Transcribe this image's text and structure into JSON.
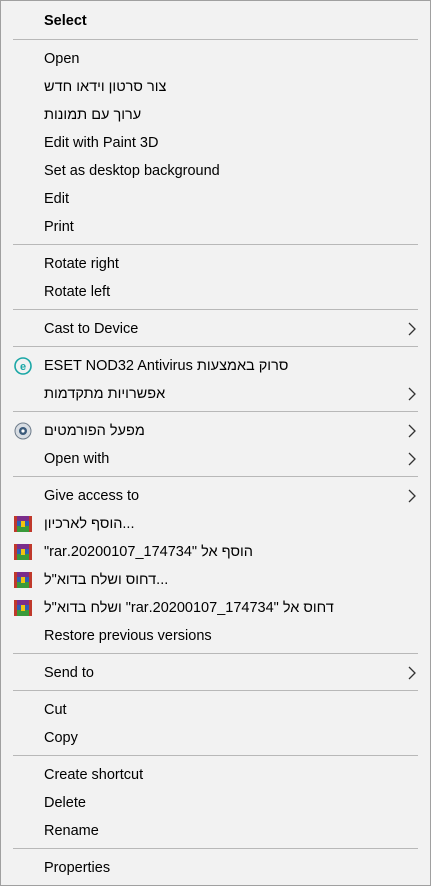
{
  "menu": {
    "select": "Select",
    "open": "Open",
    "new_video": "צור סרטון וידאו חדש",
    "edit_photos": "ערוך עם תמונות",
    "edit_paint3d": "Edit with Paint 3D",
    "set_background": "Set as desktop background",
    "edit": "Edit",
    "print": "Print",
    "rotate_right": "Rotate right",
    "rotate_left": "Rotate left",
    "cast": "Cast to Device",
    "eset_scan": "סרוק באמצעות ESET NOD32 Antivirus",
    "advanced_options": "אפשרויות מתקדמות",
    "format_factory": "מפעל הפורמטים",
    "open_with": "Open with",
    "give_access": "Give access to",
    "add_archive": "...הוסף לארכיון",
    "add_to_rar": "הוסף אל \"174734_20200107.rar\"",
    "compress_email": "...דחוס ושלח בדוא\"ל",
    "compress_rar_email": "דחוס אל \"174734_20200107.rar\" ושלח בדוא\"ל",
    "restore_versions": "Restore previous versions",
    "send_to": "Send to",
    "cut": "Cut",
    "copy": "Copy",
    "create_shortcut": "Create shortcut",
    "delete": "Delete",
    "rename": "Rename",
    "properties": "Properties"
  },
  "icons": {
    "eset": "eset-icon",
    "format_factory": "format-factory-icon",
    "winrar": "winrar-icon",
    "submenu": "chevron-right-icon"
  },
  "colors": {
    "menu_bg": "#f2f2f2",
    "separator": "#b8b8b8",
    "eset_teal": "#1aa7a6",
    "winrar_red": "#c0392b",
    "winrar_blue": "#2d5fb5",
    "winrar_green": "#3a9a3a"
  }
}
